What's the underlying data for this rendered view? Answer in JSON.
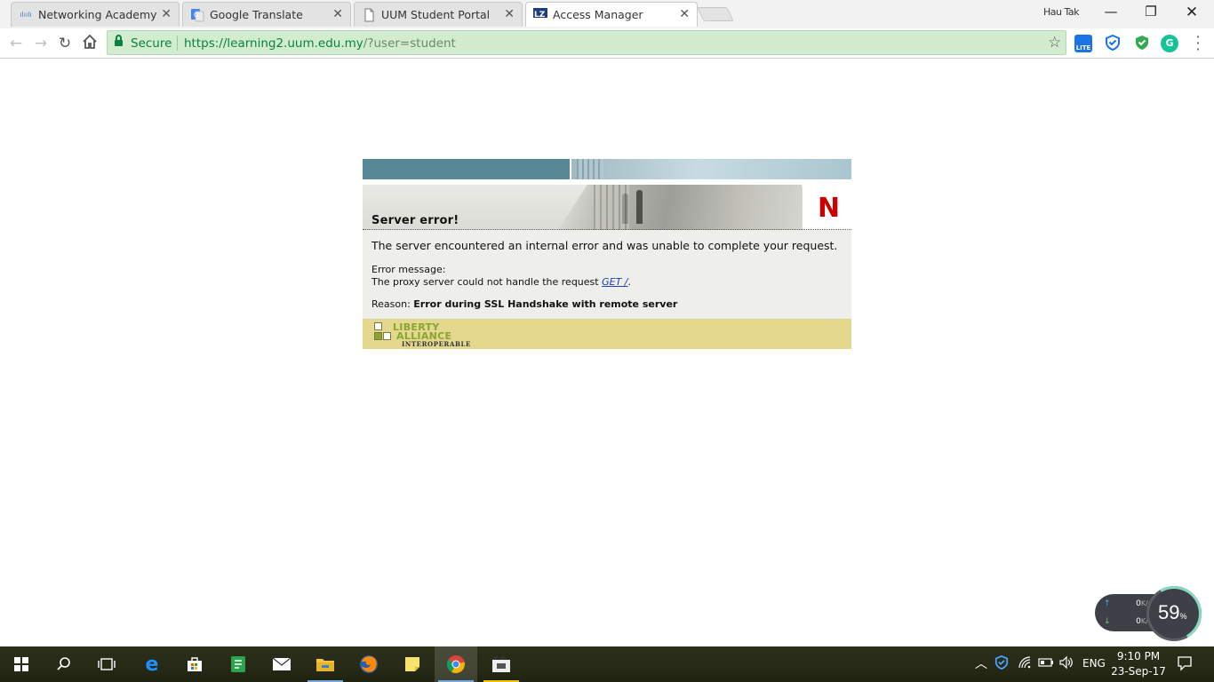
{
  "browser": {
    "tabs": [
      {
        "title": "Networking Academy Ho",
        "favicon": "cisco-icon",
        "active": false
      },
      {
        "title": "Google Translate",
        "favicon": "google-translate-icon",
        "active": false
      },
      {
        "title": "UUM Student Portal",
        "favicon": "page-icon",
        "active": false
      },
      {
        "title": "Access Manager",
        "favicon": "lz-uum-icon",
        "active": true
      }
    ],
    "profile_name": "Hau Tak",
    "omnibox": {
      "secure_label": "Secure",
      "url_host": "https://learning2.uum.edu.my",
      "url_path": "/?user=student"
    },
    "extensions": [
      {
        "name": "lite-icon",
        "label": "LITE",
        "color": "#1a73e8"
      },
      {
        "name": "shield-check-icon",
        "label": "",
        "color": "#1a73e8"
      },
      {
        "name": "green-shield-icon",
        "label": "",
        "color": "#34a853"
      },
      {
        "name": "grammarly-icon",
        "label": "G",
        "color": "#15c39a"
      }
    ]
  },
  "error_page": {
    "heading": "Server error!",
    "lead": "The server encountered an internal error and was unable to complete your request.",
    "error_label": "Error message:",
    "error_text": "The proxy server could not handle the request",
    "error_link": "GET /",
    "error_suffix": ".",
    "reason_label": "Reason:",
    "reason_text": "Error during SSL Handshake with remote server",
    "brand_logo": "N",
    "footer_logo": {
      "line1": "LIBERTY",
      "line2": "ALLIANCE",
      "line3": "INTEROPERABLE"
    }
  },
  "net_widget": {
    "upload": "0",
    "download": "0",
    "unit": "K/s",
    "percent": "59",
    "percent_sign": "%"
  },
  "taskbar": {
    "language": "ENG",
    "time": "9:10 PM",
    "date": "23-Sep-17"
  }
}
